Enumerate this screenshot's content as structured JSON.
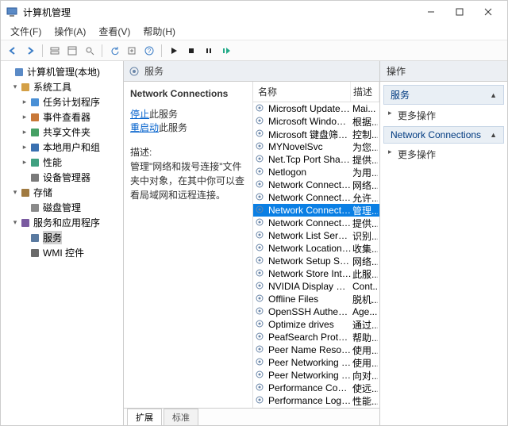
{
  "window": {
    "title": "计算机管理"
  },
  "menubar": [
    "文件(F)",
    "操作(A)",
    "查看(V)",
    "帮助(H)"
  ],
  "tree": [
    {
      "label": "计算机管理(本地)",
      "indent": 0,
      "tog": "",
      "icon": "computer"
    },
    {
      "label": "系统工具",
      "indent": 1,
      "tog": "▾",
      "icon": "tool"
    },
    {
      "label": "任务计划程序",
      "indent": 2,
      "tog": "▸",
      "icon": "clock"
    },
    {
      "label": "事件查看器",
      "indent": 2,
      "tog": "▸",
      "icon": "event"
    },
    {
      "label": "共享文件夹",
      "indent": 2,
      "tog": "▸",
      "icon": "share"
    },
    {
      "label": "本地用户和组",
      "indent": 2,
      "tog": "▸",
      "icon": "users"
    },
    {
      "label": "性能",
      "indent": 2,
      "tog": "▸",
      "icon": "perf"
    },
    {
      "label": "设备管理器",
      "indent": 2,
      "tog": "",
      "icon": "device"
    },
    {
      "label": "存储",
      "indent": 1,
      "tog": "▾",
      "icon": "storage"
    },
    {
      "label": "磁盘管理",
      "indent": 2,
      "tog": "",
      "icon": "disk"
    },
    {
      "label": "服务和应用程序",
      "indent": 1,
      "tog": "▾",
      "icon": "app"
    },
    {
      "label": "服务",
      "indent": 2,
      "tog": "",
      "icon": "gear",
      "selected": true
    },
    {
      "label": "WMI 控件",
      "indent": 2,
      "tog": "",
      "icon": "wmi"
    }
  ],
  "midheader": "服务",
  "service_detail": {
    "name": "Network Connections",
    "stop_link": "停止",
    "stop_suffix": "此服务",
    "restart_link": "重启动",
    "restart_suffix": "此服务",
    "desc_label": "描述:",
    "desc_text": "管理\"网络和拨号连接\"文件夹中对象，在其中你可以查看局域网和远程连接。"
  },
  "svc_cols": {
    "name": "名称",
    "desc": "描述"
  },
  "services": [
    {
      "n": "Microsoft Update Health...",
      "d": "Mai..."
    },
    {
      "n": "Microsoft Windows SMS ...",
      "d": "根据..."
    },
    {
      "n": "Microsoft 键盘筛选器",
      "d": "控制..."
    },
    {
      "n": "MYNovelSvc",
      "d": "为您..."
    },
    {
      "n": "Net.Tcp Port Sharing Ser...",
      "d": "提供..."
    },
    {
      "n": "Netlogon",
      "d": "为用..."
    },
    {
      "n": "Network Connected Devi...",
      "d": "网络..."
    },
    {
      "n": "Network Connection Bro...",
      "d": "允许..."
    },
    {
      "n": "Network Connections",
      "d": "管理...",
      "sel": true
    },
    {
      "n": "Network Connectivity Ass...",
      "d": "提供..."
    },
    {
      "n": "Network List Service",
      "d": "识别..."
    },
    {
      "n": "Network Location Aware...",
      "d": "收集..."
    },
    {
      "n": "Network Setup Service",
      "d": "网络..."
    },
    {
      "n": "Network Store Interface ...",
      "d": "此服..."
    },
    {
      "n": "NVIDIA Display Containe...",
      "d": "Cont..."
    },
    {
      "n": "Offline Files",
      "d": "脱机..."
    },
    {
      "n": "OpenSSH Authentication ...",
      "d": "Age..."
    },
    {
      "n": "Optimize drives",
      "d": "通过..."
    },
    {
      "n": "PeafSearch Protect Service",
      "d": "帮助..."
    },
    {
      "n": "Peer Name Resolution Pr...",
      "d": "使用..."
    },
    {
      "n": "Peer Networking Groupi...",
      "d": "使用..."
    },
    {
      "n": "Peer Networking Identity...",
      "d": "向对..."
    },
    {
      "n": "Performance Counter DL...",
      "d": "使远..."
    },
    {
      "n": "Performance Logs & Aler...",
      "d": "性能..."
    }
  ],
  "tabs": {
    "extended": "扩展",
    "standard": "标准"
  },
  "actions": {
    "header": "操作",
    "cat1": "服务",
    "more": "更多操作",
    "cat2": "Network Connections"
  }
}
